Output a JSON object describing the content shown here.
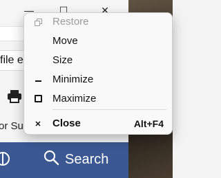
{
  "background_window": {
    "title_bar": {
      "minimize_glyph": "—",
      "maximize_glyph": "☐",
      "close_glyph": "✕"
    },
    "file_text": "file e",
    "support_text": "or Sup",
    "print_icon": "printer-icon"
  },
  "taskbar": {
    "search_label": "Search",
    "left_icon": "task-view-icon",
    "search_icon": "search-icon",
    "color": "#3b5893"
  },
  "system_menu": {
    "items": [
      {
        "label": "Restore",
        "icon": "restore-icon",
        "enabled": false,
        "shortcut": ""
      },
      {
        "label": "Move",
        "icon": "",
        "enabled": true,
        "shortcut": ""
      },
      {
        "label": "Size",
        "icon": "",
        "enabled": true,
        "shortcut": ""
      },
      {
        "label": "Minimize",
        "icon": "minimize-icon",
        "enabled": true,
        "shortcut": ""
      },
      {
        "label": "Maximize",
        "icon": "maximize-icon",
        "enabled": true,
        "shortcut": ""
      },
      {
        "label": "Close",
        "icon": "close-icon",
        "enabled": true,
        "shortcut": "Alt+F4",
        "bold": true
      }
    ]
  }
}
